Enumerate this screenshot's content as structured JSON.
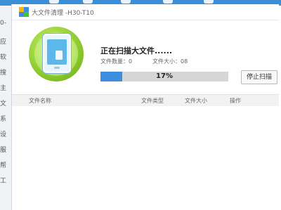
{
  "window": {
    "title": "大文件清理 -H30-T10"
  },
  "scan": {
    "heading": "正在扫描大文件......",
    "file_count_label": "文件数量：0",
    "file_size_label": "文件大小：08",
    "progress_percent": 17,
    "progress_text": "17%",
    "stop_button": "停止扫描"
  },
  "table": {
    "columns": [
      "文件名称",
      "文件类型",
      "文件大小",
      "操作"
    ],
    "rows": []
  },
  "background_sidebar": {
    "items": [
      "0-",
      "应",
      "软",
      "搜",
      "主",
      "文",
      "系",
      "设",
      "服",
      "帮",
      "工"
    ]
  },
  "colors": {
    "accent": "#3e8ee0",
    "ring_green": "#9bd43b",
    "progress_track": "#d6d6d6"
  }
}
